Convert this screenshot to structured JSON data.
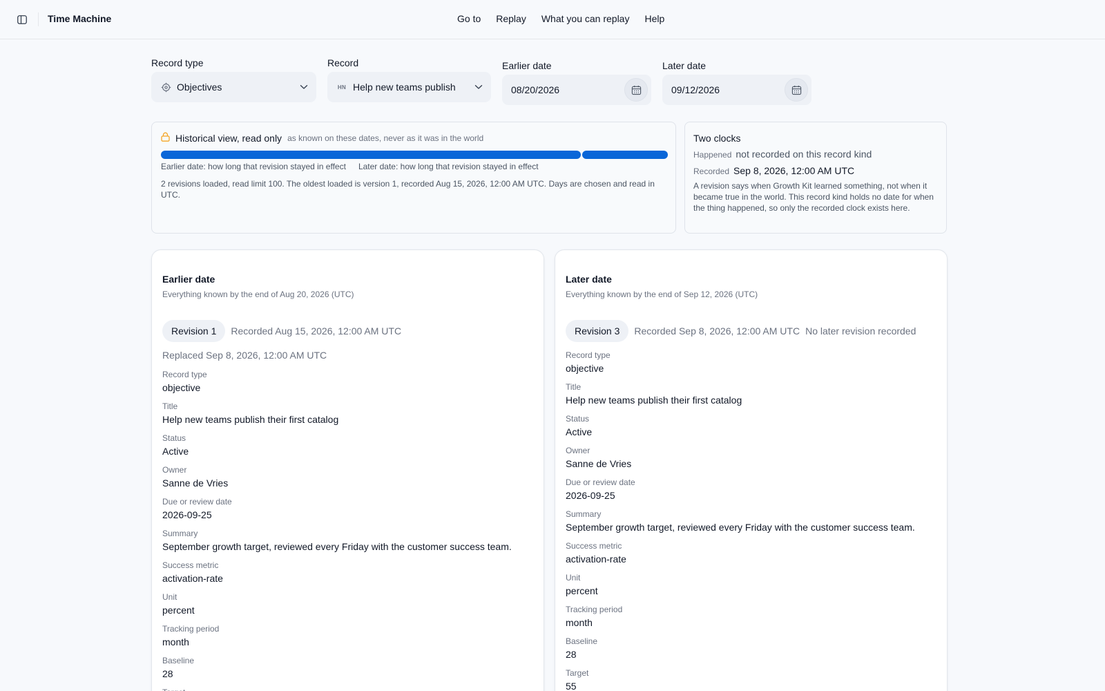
{
  "header": {
    "title": "Time Machine",
    "nav": [
      "Go to",
      "Replay",
      "What you can replay",
      "Help"
    ]
  },
  "controls": {
    "record_type": {
      "label": "Record type",
      "value": "Objectives",
      "icon": "target-icon"
    },
    "record": {
      "label": "Record",
      "value": "Help new teams publish",
      "badge": "HN"
    },
    "earlier_date": {
      "label": "Earlier date",
      "value": "08/20/2026"
    },
    "later_date": {
      "label": "Later date",
      "value": "09/12/2026"
    }
  },
  "historical": {
    "title": "Historical view, read only",
    "subtitle": "as known on these dates, never as it was in the world",
    "timeline_share": [
      0.83,
      0.17
    ],
    "legend_earlier": "Earlier date: how long that revision stayed in effect",
    "legend_later": "Later date: how long that revision stayed in effect",
    "note": "2 revisions loaded, read limit 100. The oldest loaded is version 1, recorded Aug 15, 2026, 12:00 AM UTC. Days are chosen and read in UTC."
  },
  "clocks": {
    "title": "Two clocks",
    "happened_key": "Happened",
    "happened_value": "not recorded on this record kind",
    "recorded_key": "Recorded",
    "recorded_value": "Sep 8, 2026, 12:00 AM UTC",
    "note": "A revision says when Growth Kit learned something, not when it became true in the world. This record kind holds no date for when the thing happened, so only the recorded clock exists here."
  },
  "earlier_panel": {
    "title": "Earlier date",
    "subtitle": "Everything known by the end of Aug 20, 2026 (UTC)",
    "revision": "Revision 1",
    "recorded": "Recorded Aug 15, 2026, 12:00 AM UTC",
    "replaced": "Replaced Sep 8, 2026, 12:00 AM UTC",
    "fields": [
      {
        "label": "Record type",
        "value": "objective"
      },
      {
        "label": "Title",
        "value": "Help new teams publish their first catalog"
      },
      {
        "label": "Status",
        "value": "Active"
      },
      {
        "label": "Owner",
        "value": "Sanne de Vries"
      },
      {
        "label": "Due or review date",
        "value": "2026-09-25"
      },
      {
        "label": "Summary",
        "value": "September growth target, reviewed every Friday with the customer success team."
      },
      {
        "label": "Success metric",
        "value": "activation-rate"
      },
      {
        "label": "Unit",
        "value": "percent"
      },
      {
        "label": "Tracking period",
        "value": "month"
      },
      {
        "label": "Baseline",
        "value": "28"
      },
      {
        "label": "Target",
        "value": ""
      }
    ]
  },
  "later_panel": {
    "title": "Later date",
    "subtitle": "Everything known by the end of Sep 12, 2026 (UTC)",
    "revision": "Revision 3",
    "recorded": "Recorded Sep 8, 2026, 12:00 AM UTC",
    "no_later": "No later revision recorded",
    "fields": [
      {
        "label": "Record type",
        "value": "objective"
      },
      {
        "label": "Title",
        "value": "Help new teams publish their first catalog"
      },
      {
        "label": "Status",
        "value": "Active"
      },
      {
        "label": "Owner",
        "value": "Sanne de Vries"
      },
      {
        "label": "Due or review date",
        "value": "2026-09-25"
      },
      {
        "label": "Summary",
        "value": "September growth target, reviewed every Friday with the customer success team."
      },
      {
        "label": "Success metric",
        "value": "activation-rate"
      },
      {
        "label": "Unit",
        "value": "percent"
      },
      {
        "label": "Tracking period",
        "value": "month"
      },
      {
        "label": "Baseline",
        "value": "28"
      },
      {
        "label": "Target",
        "value": "55"
      }
    ]
  },
  "colors": {
    "accent": "#0a66d8",
    "lock": "#f5a524"
  }
}
